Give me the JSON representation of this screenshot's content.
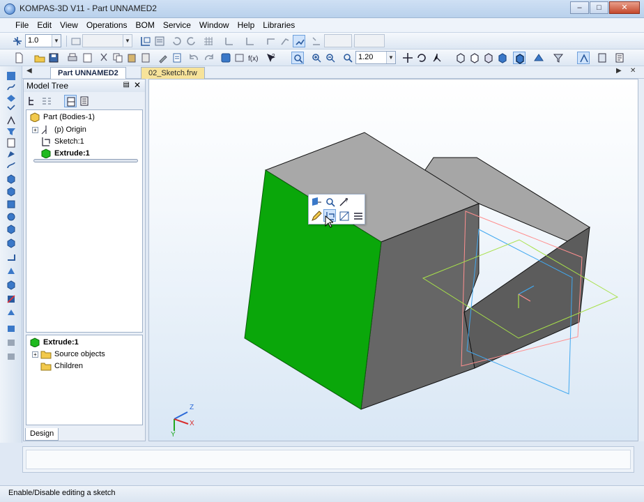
{
  "window": {
    "title": "KOMPAS-3D V11 - Part UNNAMED2"
  },
  "menu": [
    "File",
    "Edit",
    "View",
    "Operations",
    "BOM",
    "Service",
    "Window",
    "Help",
    "Libraries"
  ],
  "toolbar": {
    "scale_value": "1.0",
    "zoom_value": "1.20"
  },
  "doc_tabs": {
    "active": "Part UNNAMED2",
    "second": "02_Sketch.frw"
  },
  "panel": {
    "title": "Model Tree",
    "tab": "Design"
  },
  "tree": {
    "root": "Part (Bodies-1)",
    "origin": "(p) Origin",
    "sketch": "Sketch:1",
    "extrude": "Extrude:1"
  },
  "tree_detail": {
    "title": "Extrude:1",
    "source": "Source objects",
    "children": "Children"
  },
  "axes": {
    "x": "X",
    "y": "Y",
    "z": "Z"
  },
  "status": {
    "hint": "Enable/Disable editing a sketch"
  },
  "colors": {
    "face_green": "#0aa70a",
    "body_gray": "#6f6f6f",
    "accent": "#3a78c8"
  }
}
